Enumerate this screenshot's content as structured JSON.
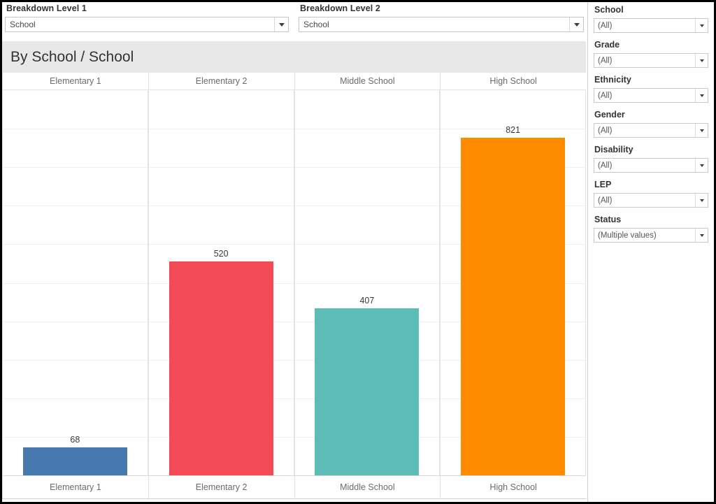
{
  "breakdown": {
    "level1": {
      "label": "Breakdown Level 1",
      "value": "School"
    },
    "level2": {
      "label": "Breakdown Level 2",
      "value": "School"
    }
  },
  "chart_panel": {
    "title": "By School / School"
  },
  "filters": [
    {
      "label": "School",
      "value": "(All)"
    },
    {
      "label": "Grade",
      "value": "(All)"
    },
    {
      "label": "Ethnicity",
      "value": "(All)"
    },
    {
      "label": "Gender",
      "value": "(All)"
    },
    {
      "label": "Disability",
      "value": "(All)"
    },
    {
      "label": "LEP",
      "value": "(All)"
    },
    {
      "label": "Status",
      "value": "(Multiple values)"
    }
  ],
  "chart_data": {
    "type": "bar",
    "title": "By School / School",
    "xlabel": "",
    "ylabel": "",
    "categories": [
      "Elementary 1",
      "Elementary 2",
      "Middle School",
      "High School"
    ],
    "values": [
      68,
      520,
      407,
      821
    ],
    "value_labels": [
      "68",
      "520",
      "407",
      "821"
    ],
    "colors": [
      "#4679AD",
      "#F24B56",
      "#5EBCB6",
      "#FF8C00"
    ],
    "ylim": [
      0,
      900
    ],
    "grid": true,
    "gridline_count": 9,
    "legend": "none",
    "column_headers": [
      "Elementary 1",
      "Elementary 2",
      "Middle School",
      "High School"
    ],
    "axis_labels": [
      "Elementary 1",
      "Elementary 2",
      "Middle School",
      "High School"
    ]
  }
}
